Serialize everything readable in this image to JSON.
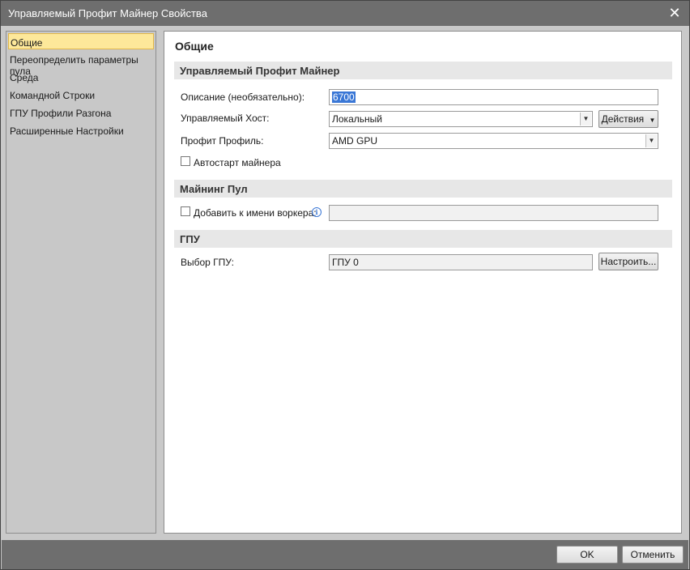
{
  "window": {
    "title": "Управляемый Профит Майнер Свойства",
    "close_glyph": "✕"
  },
  "sidebar": {
    "items": [
      {
        "label": "Общие",
        "selected": true
      },
      {
        "label": "Переопределить параметры пула",
        "selected": false
      },
      {
        "label": "Среда",
        "selected": false
      },
      {
        "label": "Командной Строки",
        "selected": false
      },
      {
        "label": "ГПУ Профили Разгона",
        "selected": false
      },
      {
        "label": "Расширенные Настройки",
        "selected": false
      }
    ]
  },
  "main": {
    "page_title": "Общие",
    "sections": {
      "miner": {
        "header": "Управляемый Профит Майнер",
        "description_label": "Описание (необязательно):",
        "description_value": "6700",
        "host_label": "Управляемый Хост:",
        "host_value": "Локальный",
        "actions_label": "Действия",
        "profile_label": "Профит Профиль:",
        "profile_value": "AMD GPU",
        "autostart_label": "Автостарт майнера",
        "autostart_checked": false
      },
      "pool": {
        "header": "Майнинг Пул",
        "worker_label": "Добавить к имени воркера:",
        "worker_checked": false,
        "worker_value": ""
      },
      "gpu": {
        "header": "ГПУ",
        "select_label": "Выбор ГПУ:",
        "select_value": "ГПУ 0",
        "configure_label": "Настроить..."
      }
    }
  },
  "footer": {
    "ok_label": "OK",
    "cancel_label": "Отменить"
  },
  "colors": {
    "titlebar": "#6e6e6e",
    "selection_highlight": "#fde89a",
    "text_selection": "#3a77d6"
  }
}
